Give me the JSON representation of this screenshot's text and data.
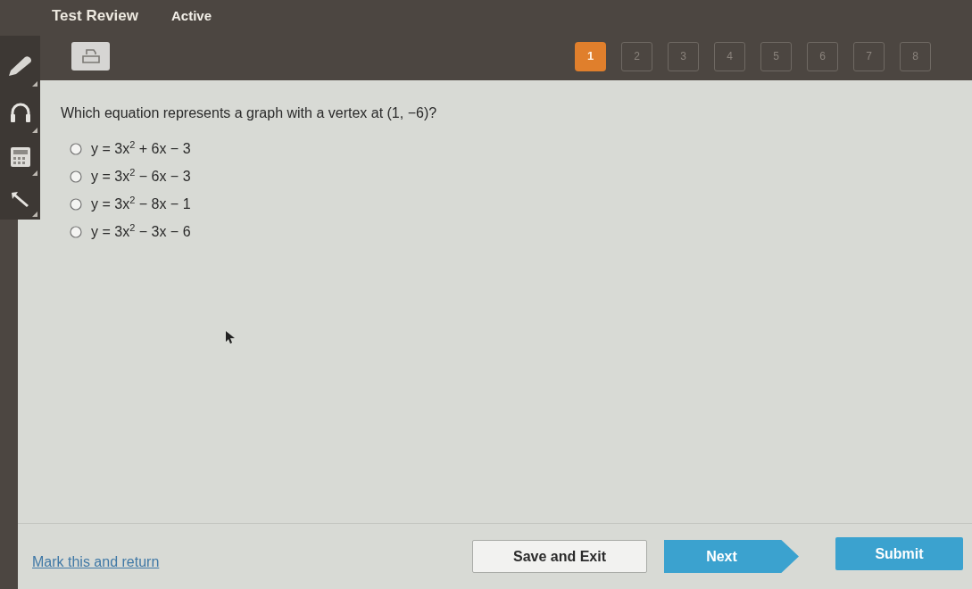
{
  "header": {
    "title": "Test Review",
    "status": "Active"
  },
  "question_nav": [
    {
      "label": "1",
      "selected": true
    },
    {
      "label": "2",
      "selected": false
    },
    {
      "label": "3",
      "selected": false
    },
    {
      "label": "4",
      "selected": false
    },
    {
      "label": "5",
      "selected": false
    },
    {
      "label": "6",
      "selected": false
    },
    {
      "label": "7",
      "selected": false
    },
    {
      "label": "8",
      "selected": false
    }
  ],
  "question": {
    "prompt": "Which equation represents a graph with a vertex at (1, −6)?",
    "options": [
      {
        "label": "y = 3x$^{2}$ + 6x − 3",
        "selected": false
      },
      {
        "label": "y = 3x$^{2}$ − 6x − 3",
        "selected": false
      },
      {
        "label": "y = 3x$^{2}$ − 8x − 1",
        "selected": false
      },
      {
        "label": "y = 3x$^{2}$ − 3x − 6",
        "selected": false
      }
    ]
  },
  "footer": {
    "mark_link": "Mark this and return",
    "buttons": [
      {
        "kind": "secondary",
        "label": "Save and Exit"
      },
      {
        "kind": "next",
        "label": "Next"
      },
      {
        "kind": "primary",
        "label": "Submit"
      }
    ]
  }
}
